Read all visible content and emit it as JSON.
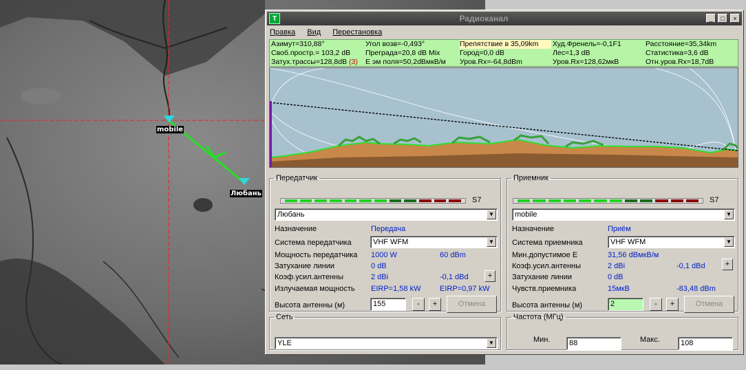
{
  "map": {
    "markers": [
      {
        "label": "mobile"
      },
      {
        "label": "Любань"
      }
    ]
  },
  "window": {
    "title": "Радиоканал",
    "controls": [
      "_",
      "□",
      "×"
    ],
    "menu": [
      "Правка",
      "Вид",
      "Перестановка"
    ]
  },
  "info": {
    "row0": [
      "Азимут=310,88°",
      "Угол возв=-0,493°",
      "Препятствие в 35,09km",
      "Худ.Френель=-0,1F1",
      "Расстояние=35,34km"
    ],
    "row1": [
      "Своб.простр.= 103,2 dB",
      "Преграда=20,8 dB Mix",
      "Город=0,0 dB",
      "Лес=1,3 dB",
      "Статистика=3,6 dB"
    ],
    "row2": [
      "Затух.трассы=128,8dB",
      "(3)",
      "Е эм поля=50,2dBмкВ/м",
      "Уров.Rx=-64,8dBm",
      "Уров.Rx=128,62мкВ",
      "Отн.уров.Rx=18,7dB"
    ]
  },
  "transmitter": {
    "legend": "Передатчик",
    "s_level": "S7",
    "station": "Любань",
    "purpose_label": "Назначение",
    "purpose_value": "Передача",
    "system_label": "Система передатчика",
    "system_value": "VHF WFM",
    "power_label": "Мощность передатчика",
    "power_w": "1000 W",
    "power_dbm": "60 dBm",
    "line_loss_label": "Затухание линии",
    "line_loss": "0 dB",
    "gain_label": "Коэф.усил.антенны",
    "gain_dbi": "2 dBi",
    "gain_dbd": "-0,1 dBd",
    "radiated_label": "Излучаемая мощность",
    "eirp1": "EIRP=1,58 kW",
    "eirp2": "EIRP=0,97 kW",
    "height_label": "Высота антенны (м)",
    "height_value": "155",
    "minus": "-",
    "plus": "+",
    "cancel": "Отмена"
  },
  "receiver": {
    "legend": "Приемник",
    "s_level": "S7",
    "station": "mobile",
    "purpose_label": "Назначение",
    "purpose_value": "Приём",
    "system_label": "Система приемника",
    "system_value": "VHF WFM",
    "min_e_label": "Мин.допустимое Е",
    "min_e": "31,56 dBмкВ/м",
    "gain_label": "Коэф.усил.антенны",
    "gain_dbi": "2 dBi",
    "gain_dbd": "-0,1 dBd",
    "line_loss_label": "Затухание линии",
    "line_loss": "0 dB",
    "sens_label": "Чувств.приемника",
    "sens_uv": "15мкВ",
    "sens_dbm": "-83,48 dBm",
    "height_label": "Высота антенны (м)",
    "height_value": "2",
    "minus": "-",
    "plus": "+",
    "cancel": "Отмена"
  },
  "network": {
    "legend": "Сеть",
    "value": "YLE"
  },
  "frequency": {
    "legend": "Частота (МГц)",
    "min_label": "Мин.",
    "min_value": "88",
    "max_label": "Макс.",
    "max_value": "108"
  },
  "colors": {
    "titlebar": "#4a4a4a",
    "info_bg": "#b5f5a5",
    "sky": "#a7c1cf",
    "terrain": "#c8884a",
    "field_value": "#0020c8",
    "meter_green": "#1ed41e",
    "meter_dark_green": "#1a6b1a",
    "meter_red": "#8b0000"
  }
}
